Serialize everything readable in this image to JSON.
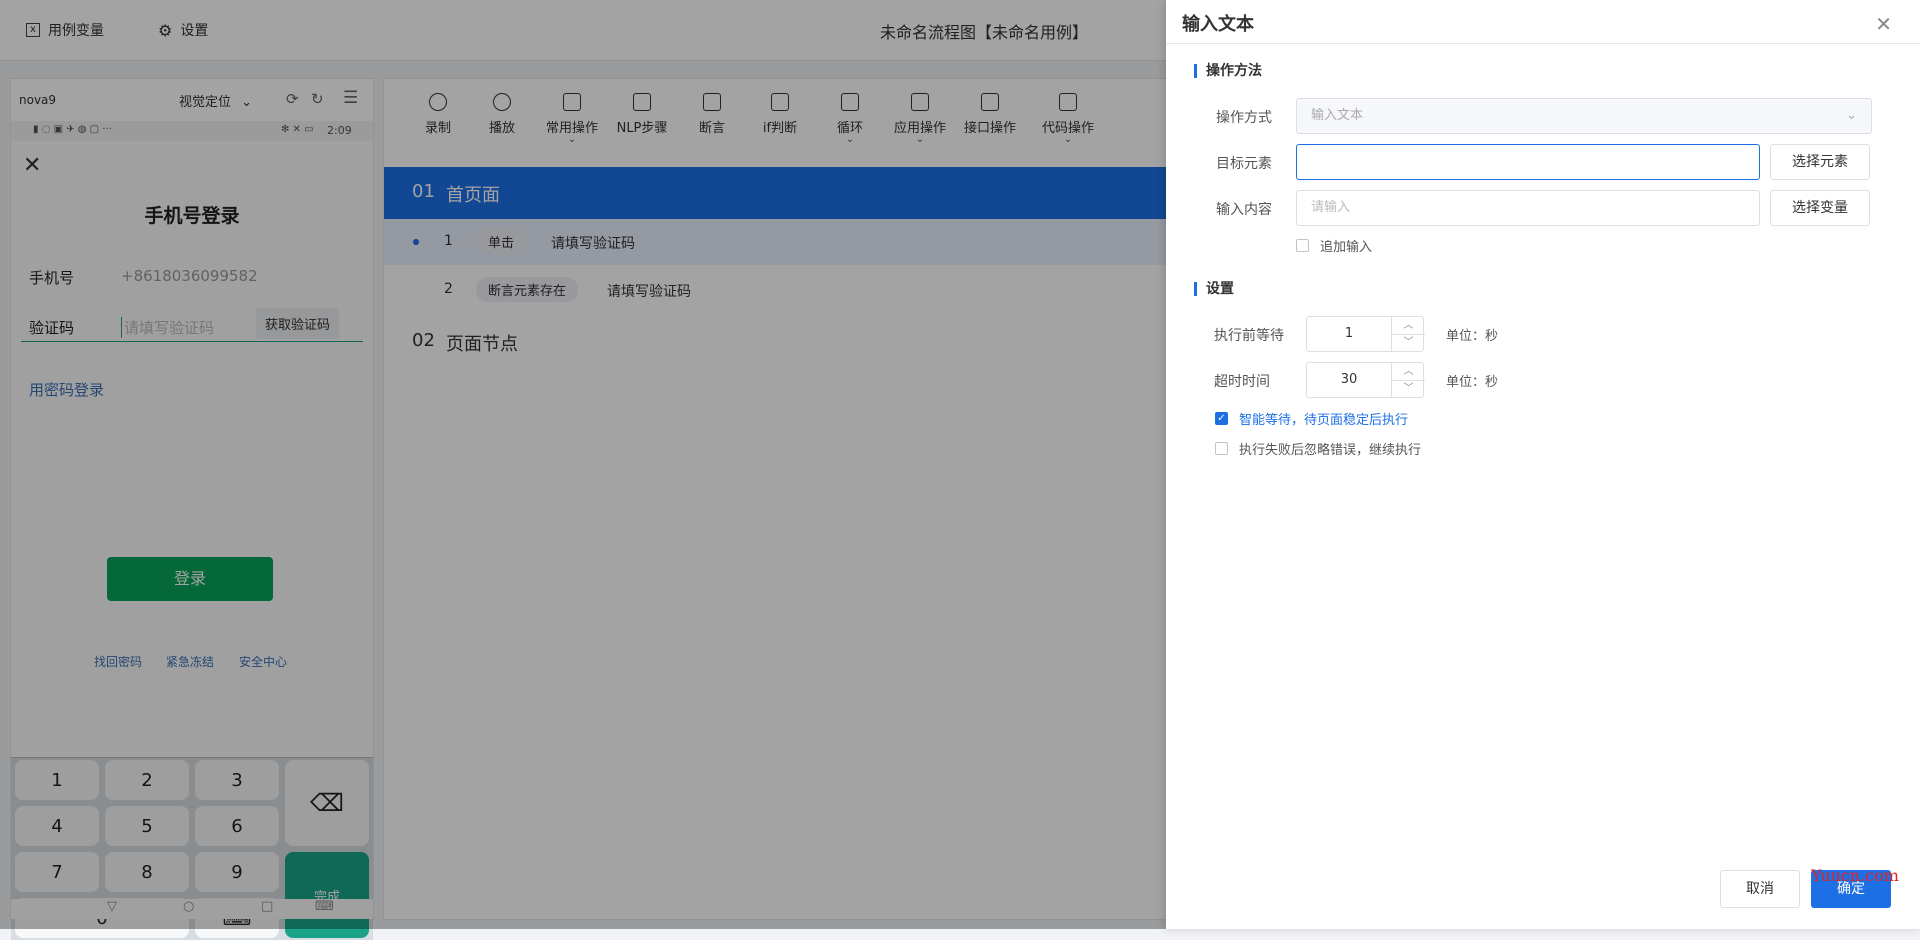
{
  "topbar": {
    "case_variables": "用例变量",
    "settings": "设置",
    "title": "未命名流程图【未命名用例】"
  },
  "device": {
    "name": "nova9",
    "mode": "视觉定位",
    "status_time": "2:09",
    "page_title": "手机号登录",
    "phone_label": "手机号",
    "phone_value": "+8618036099582",
    "code_label": "验证码",
    "code_placeholder": "请填写验证码",
    "get_code": "获取验证码",
    "password_login": "用密码登录",
    "login": "登录",
    "links": [
      "找回密码",
      "紧急冻结",
      "安全中心"
    ],
    "keys": [
      "1",
      "2",
      "3",
      "4",
      "5",
      "6",
      "7",
      "8",
      "9",
      "0"
    ],
    "done": "完成"
  },
  "toolbar": {
    "items": [
      "录制",
      "播放",
      "常用操作",
      "NLP步骤",
      "断言",
      "if判断",
      "循环",
      "应用操作",
      "接口操作",
      "代码操作"
    ]
  },
  "flow": {
    "section1_no": "01",
    "section1_name": "首页面",
    "steps": [
      {
        "no": "1",
        "action": "单击",
        "target": "请填写验证码"
      },
      {
        "no": "2",
        "action": "断言元素存在",
        "target": "请填写验证码"
      }
    ],
    "section2_no": "02",
    "section2_name": "页面节点"
  },
  "drawer": {
    "title": "输入文本",
    "group_method": "操作方法",
    "method_label": "操作方式",
    "method_value": "输入文本",
    "target_label": "目标元素",
    "select_element": "选择元素",
    "content_label": "输入内容",
    "content_placeholder": "请输入",
    "select_variable": "选择变量",
    "append_input": "追加输入",
    "group_settings": "设置",
    "wait_label": "执行前等待",
    "wait_value": "1",
    "unit_label": "单位：秒",
    "timeout_label": "超时时间",
    "timeout_value": "30",
    "smart_wait": "智能等待，待页面稳定后执行",
    "ignore_error": "执行失败后忽略错误，继续执行",
    "cancel": "取消",
    "confirm": "确定",
    "watermark": "Yuucn.com"
  },
  "colors": {
    "accent": "#1d6fe6",
    "login_green": "#07a35a",
    "done_teal": "#1aa389"
  }
}
